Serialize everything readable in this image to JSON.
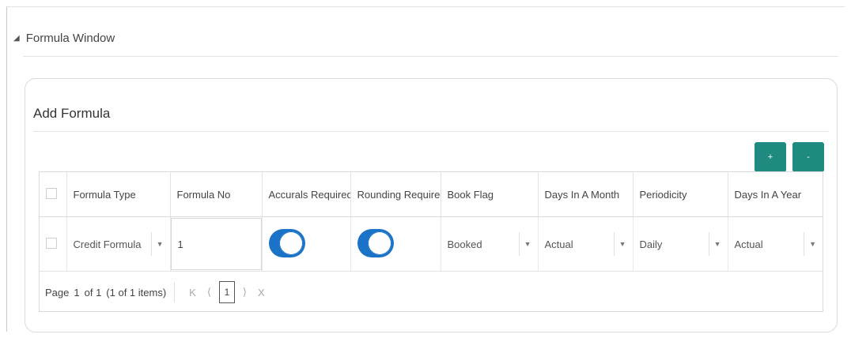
{
  "section": {
    "title": "Formula Window"
  },
  "card": {
    "title": "Add Formula"
  },
  "buttons": {
    "add": "+",
    "remove": "-"
  },
  "grid": {
    "columns": [
      "Formula Type",
      "Formula No",
      "Accurals Required",
      "Rounding Required",
      "Book Flag",
      "Days In A Month",
      "Periodicity",
      "Days In A Year"
    ],
    "rows": [
      {
        "formula_type": "Credit Formula",
        "formula_no": "1",
        "accurals_required": true,
        "rounding_required": true,
        "book_flag": "Booked",
        "days_in_month": "Actual",
        "periodicity": "Daily",
        "days_in_year": "Actual"
      }
    ]
  },
  "pager": {
    "page_label": "Page",
    "page_value": "1",
    "of_label": "of 1",
    "items_label": "(1 of 1 items)",
    "current_page": "1"
  },
  "colors": {
    "accent_button": "#1f8a80",
    "toggle_on": "#1a73c6"
  }
}
